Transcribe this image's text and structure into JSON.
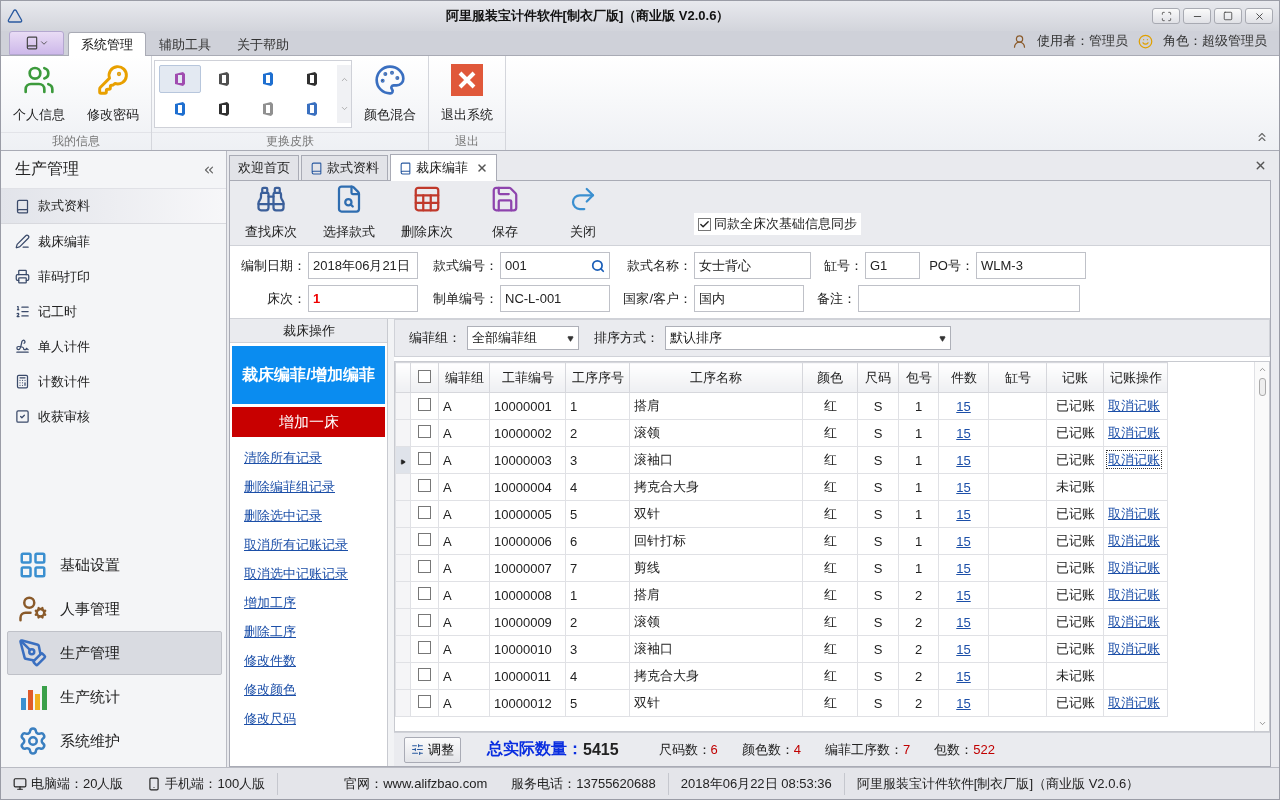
{
  "window": {
    "title": "阿里服装宝计件软件[制衣厂版]（商业版 V2.0.6）"
  },
  "ribbon_tabs": [
    {
      "label": "系统管理",
      "selected": true
    },
    {
      "label": "辅助工具",
      "selected": false
    },
    {
      "label": "关于帮助",
      "selected": false
    }
  ],
  "user_info": {
    "user": "使用者：管理员",
    "role": "角色：超级管理员"
  },
  "ribbon_groups": [
    {
      "label": "我的信息",
      "buttons": [
        {
          "label": "个人信息",
          "kind": "users"
        },
        {
          "label": "修改密码",
          "kind": "key"
        }
      ]
    },
    {
      "label": "更换皮肤",
      "skins": [
        {
          "color": "#a04cb0",
          "selected": true
        },
        {
          "color": "#505050",
          "selected": false
        },
        {
          "color": "#1e6fd0",
          "selected": false
        },
        {
          "color": "#303030",
          "selected": false
        },
        {
          "color": "#1e6fd0",
          "selected": false
        },
        {
          "color": "#303030",
          "selected": false
        },
        {
          "color": "#909090",
          "selected": false
        },
        {
          "color": "#3a70c0",
          "selected": false
        }
      ],
      "buttons": [
        {
          "label": "颜色混合",
          "kind": "palette"
        }
      ]
    },
    {
      "label": "退出",
      "buttons": [
        {
          "label": "退出系统",
          "kind": "exit"
        }
      ]
    }
  ],
  "sidebar": {
    "title": "生产管理",
    "items": [
      {
        "label": "款式资料",
        "kind": "book",
        "selected": true
      },
      {
        "label": "裁床编菲",
        "kind": "pen",
        "selected": false
      },
      {
        "label": "菲码打印",
        "kind": "printer",
        "selected": false
      },
      {
        "label": "记工时",
        "kind": "list",
        "selected": false
      },
      {
        "label": "单人计件",
        "kind": "sign",
        "selected": false
      },
      {
        "label": "计数计件",
        "kind": "count",
        "selected": false
      },
      {
        "label": "收获审核",
        "kind": "check",
        "selected": false
      }
    ],
    "modules": [
      {
        "label": "基础设置",
        "kind": "base",
        "selected": false
      },
      {
        "label": "人事管理",
        "kind": "people",
        "selected": false
      },
      {
        "label": "生产管理",
        "kind": "production",
        "selected": true
      },
      {
        "label": "生产统计",
        "kind": "stats",
        "selected": false
      },
      {
        "label": "系统维护",
        "kind": "gear",
        "selected": false
      }
    ]
  },
  "doc_tabs": [
    {
      "label": "欢迎首页",
      "icon": false,
      "selected": false
    },
    {
      "label": "款式资料",
      "icon": true,
      "selected": false
    },
    {
      "label": "裁床编菲",
      "icon": true,
      "selected": true
    }
  ],
  "toolbar": [
    {
      "label": "查找床次",
      "kind": "find"
    },
    {
      "label": "选择款式",
      "kind": "select"
    },
    {
      "label": "删除床次",
      "kind": "delete"
    },
    {
      "label": "保存",
      "kind": "save"
    },
    {
      "label": "关闭",
      "kind": "close"
    }
  ],
  "sync_checkbox": {
    "label": "同款全床次基础信息同步",
    "checked": true
  },
  "form": [
    [
      {
        "label": "编制日期：",
        "value": "2018年06月21日"
      },
      {
        "label": "款式编号：",
        "value": "001",
        "kind": "search"
      },
      {
        "label": "款式名称：",
        "value": "女士背心"
      },
      {
        "label": "缸号：",
        "value": "G1"
      },
      {
        "label": "PO号：",
        "value": "WLM-3"
      }
    ],
    [
      {
        "label": "床次：",
        "value": "1",
        "highlight": true
      },
      {
        "label": "制单编号：",
        "value": "NC-L-001"
      },
      {
        "label": "国家/客户：",
        "value": "国内"
      },
      {
        "label": "备注："
      }
    ]
  ],
  "operations": {
    "title": "裁床操作",
    "primary": "裁床编菲/增加编菲",
    "secondary": "增加一床",
    "links": [
      "清除所有记录",
      "删除编菲组记录",
      "删除选中记录",
      "取消所有记账记录",
      "取消选中记账记录",
      "增加工序",
      "删除工序",
      "修改件数",
      "修改颜色",
      "修改尺码"
    ]
  },
  "filters": [
    {
      "label": "编菲组：",
      "value": "全部编菲组"
    },
    {
      "label": "排序方式：",
      "value": "默认排序"
    }
  ],
  "table": {
    "all_checked": false,
    "columns": [
      "编菲组",
      "工菲编号",
      "工序序号",
      "工序名称",
      "颜色",
      "尺码",
      "包号",
      "件数",
      "缸号",
      "记账",
      "记账操作"
    ],
    "rows": [
      {
        "checked": false,
        "current": false,
        "cells": {
          "group": "A",
          "code": "10000001",
          "seq": "1",
          "process": "搭肩",
          "shade": "红",
          "size": "S",
          "bundle": "1",
          "qty": "15",
          "status": "已记账",
          "action": "取消记账"
        }
      },
      {
        "checked": false,
        "current": false,
        "cells": {
          "group": "A",
          "code": "10000002",
          "seq": "2",
          "process": "滚领",
          "shade": "红",
          "size": "S",
          "bundle": "1",
          "qty": "15",
          "status": "已记账",
          "action": "取消记账"
        }
      },
      {
        "checked": false,
        "current": true,
        "cells": {
          "group": "A",
          "code": "10000003",
          "seq": "3",
          "process": "滚袖口",
          "shade": "红",
          "size": "S",
          "bundle": "1",
          "qty": "15",
          "status": "已记账",
          "action": "取消记账"
        }
      },
      {
        "checked": false,
        "current": false,
        "cells": {
          "group": "A",
          "code": "10000004",
          "seq": "4",
          "process": "拷克合大身",
          "shade": "红",
          "size": "S",
          "bundle": "1",
          "qty": "15",
          "status": "未记账"
        }
      },
      {
        "checked": false,
        "current": false,
        "cells": {
          "group": "A",
          "code": "10000005",
          "seq": "5",
          "process": "双针",
          "shade": "红",
          "size": "S",
          "bundle": "1",
          "qty": "15",
          "status": "已记账",
          "action": "取消记账"
        }
      },
      {
        "checked": false,
        "current": false,
        "cells": {
          "group": "A",
          "code": "10000006",
          "seq": "6",
          "process": "回针打标",
          "shade": "红",
          "size": "S",
          "bundle": "1",
          "qty": "15",
          "status": "已记账",
          "action": "取消记账"
        }
      },
      {
        "checked": false,
        "current": false,
        "cells": {
          "group": "A",
          "code": "10000007",
          "seq": "7",
          "process": "剪线",
          "shade": "红",
          "size": "S",
          "bundle": "1",
          "qty": "15",
          "status": "已记账",
          "action": "取消记账"
        }
      },
      {
        "checked": false,
        "current": false,
        "cells": {
          "group": "A",
          "code": "10000008",
          "seq": "1",
          "process": "搭肩",
          "shade": "红",
          "size": "S",
          "bundle": "2",
          "qty": "15",
          "status": "已记账",
          "action": "取消记账"
        }
      },
      {
        "checked": false,
        "current": false,
        "cells": {
          "group": "A",
          "code": "10000009",
          "seq": "2",
          "process": "滚领",
          "shade": "红",
          "size": "S",
          "bundle": "2",
          "qty": "15",
          "status": "已记账",
          "action": "取消记账"
        }
      },
      {
        "checked": false,
        "current": false,
        "cells": {
          "group": "A",
          "code": "10000010",
          "seq": "3",
          "process": "滚袖口",
          "shade": "红",
          "size": "S",
          "bundle": "2",
          "qty": "15",
          "status": "已记账",
          "action": "取消记账"
        }
      },
      {
        "checked": false,
        "current": false,
        "cells": {
          "group": "A",
          "code": "10000011",
          "seq": "4",
          "process": "拷克合大身",
          "shade": "红",
          "size": "S",
          "bundle": "2",
          "qty": "15",
          "status": "未记账"
        }
      },
      {
        "checked": false,
        "current": false,
        "cells": {
          "group": "A",
          "code": "10000012",
          "seq": "5",
          "process": "双针",
          "shade": "红",
          "size": "S",
          "bundle": "2",
          "qty": "15",
          "status": "已记账",
          "action": "取消记账"
        }
      }
    ]
  },
  "summary": {
    "button": "调整",
    "total_label": "总实际数量：",
    "total_value": "5415",
    "stats": [
      {
        "label": "尺码数：",
        "value": "6"
      },
      {
        "label": "颜色数：",
        "value": "4"
      },
      {
        "label": "编菲工序数：",
        "value": "7"
      },
      {
        "label": "包数：",
        "value": "522"
      }
    ]
  },
  "status_bar": [
    {
      "text": "电脑端：20人版",
      "kind": "pc"
    },
    {
      "text": "手机端：100人版",
      "kind": "phone"
    },
    {
      "text": "官网：www.alifzbao.com",
      "kind": "text"
    },
    {
      "text": "服务电话：13755620688",
      "kind": "text"
    },
    {
      "text": "2018年06月22日 08:53:36",
      "kind": "text"
    },
    {
      "text": "阿里服装宝计件软件[制衣厂版]（商业版 V2.0.6）",
      "kind": "text"
    }
  ]
}
